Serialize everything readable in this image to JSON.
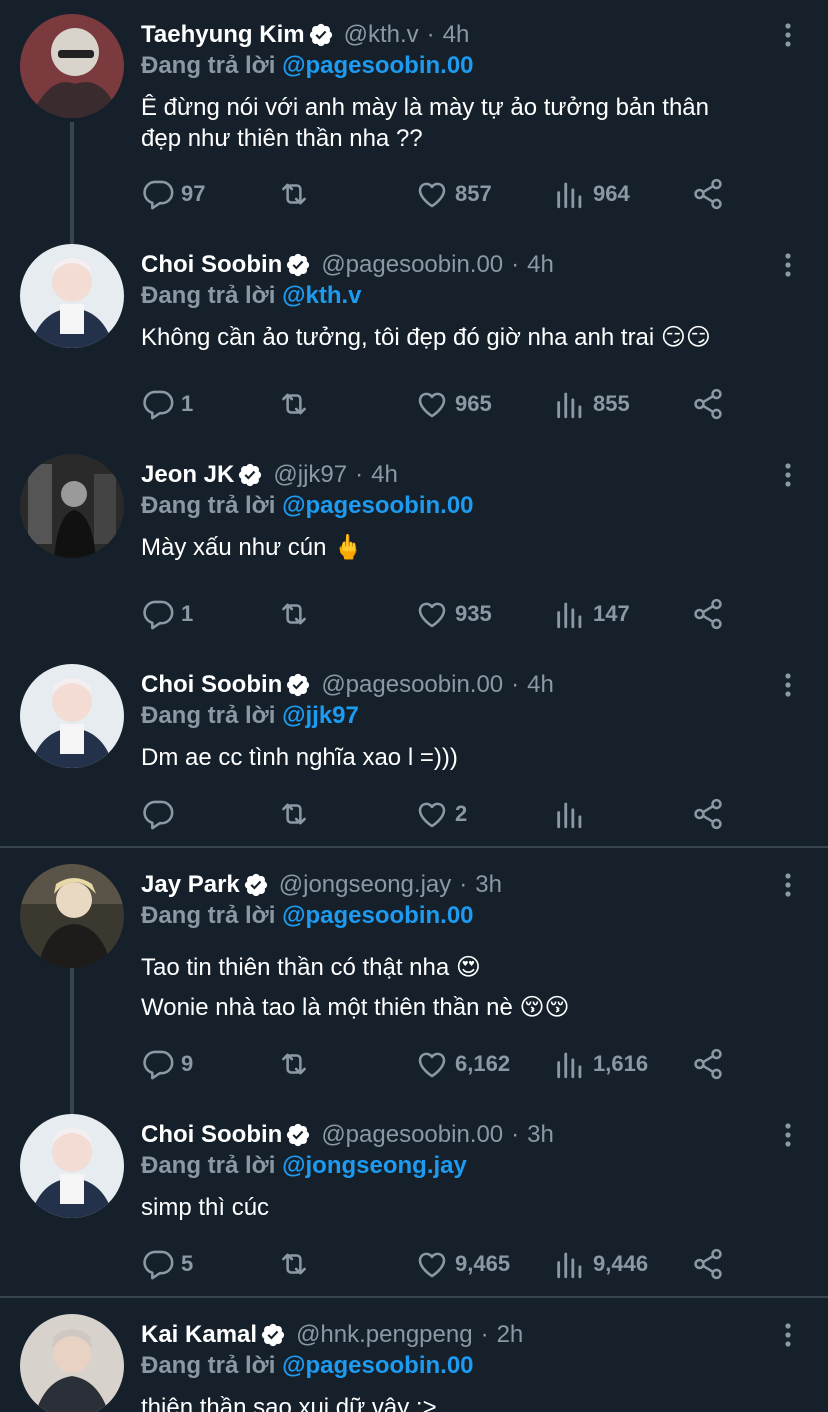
{
  "reply_prefix": "Đang trả lời",
  "tweets": [
    {
      "name": "Taehyung Kim",
      "handle": "@kth.v",
      "time": "4h",
      "reply_to": "@pagesoobin.00",
      "text_lines": [
        "Ê đừng nói với anh mày là mày tự ảo tưởng bản thân",
        "đẹp như thiên thần nha ??"
      ],
      "replies": "97",
      "retweets": "",
      "likes": "857",
      "views": "964"
    },
    {
      "name": "Choi Soobin",
      "handle": "@pagesoobin.00",
      "time": "4h",
      "reply_to": "@kth.v",
      "text_lines": [
        "Không cần ảo tưởng, tôi đẹp đó giờ nha anh trai"
      ],
      "text_emoji": [
        "😏😏"
      ],
      "replies": "1",
      "retweets": "",
      "likes": "965",
      "views": "855"
    },
    {
      "name": "Jeon JK",
      "handle": "@jjk97",
      "time": "4h",
      "reply_to": "@pagesoobin.00",
      "text_lines": [
        "Mày xấu như cún"
      ],
      "text_emoji": [
        "🖕"
      ],
      "replies": "1",
      "retweets": "",
      "likes": "935",
      "views": "147"
    },
    {
      "name": "Choi Soobin",
      "handle": "@pagesoobin.00",
      "time": "4h",
      "reply_to": "@jjk97",
      "text_lines": [
        "Dm ae cc tình nghĩa xao l =)))"
      ],
      "replies": "",
      "retweets": "",
      "likes": "2",
      "views": ""
    },
    {
      "name": "Jay Park",
      "handle": "@jongseong.jay",
      "time": "3h",
      "reply_to": "@pagesoobin.00",
      "text_lines": [
        "Tao tin thiên thần có thật nha",
        "Wonie nhà tao là một thiên thần nè"
      ],
      "text_emoji": [
        "😍",
        "😚😚"
      ],
      "replies": "9",
      "retweets": "",
      "likes": "6,162",
      "views": "1,616"
    },
    {
      "name": "Choi Soobin",
      "handle": "@pagesoobin.00",
      "time": "3h",
      "reply_to": "@jongseong.jay",
      "text_lines": [
        "simp thì cúc"
      ],
      "replies": "5",
      "retweets": "",
      "likes": "9,465",
      "views": "9,446"
    },
    {
      "name": "Kai Kamal",
      "handle": "@hnk.pengpeng",
      "time": "2h",
      "reply_to": "@pagesoobin.00",
      "text_lines": [
        "thiên thần sao xui dữ vậy :>"
      ],
      "replies": "",
      "retweets": "",
      "likes": "",
      "views": ""
    }
  ],
  "colors": {
    "background": "#15202b",
    "secondary_text": "#8b98a5",
    "link": "#1d9bf0",
    "divider": "#38444d"
  }
}
